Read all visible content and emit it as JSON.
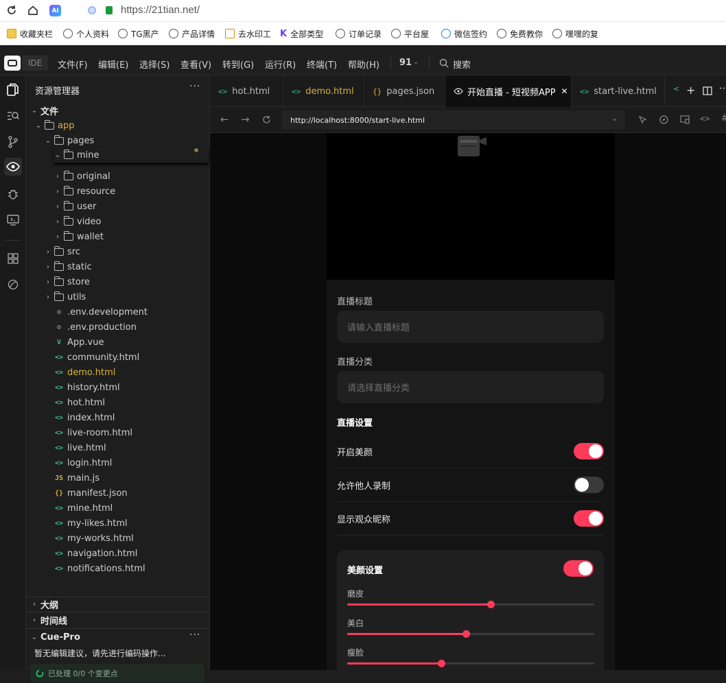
{
  "browser": {
    "url": "https://21tian.net/",
    "bookmarks": [
      "收藏夹栏",
      "个人资料",
      "TG黑产",
      "产品详情",
      "去水印工",
      "全部类型",
      "订单记录",
      "平台屋",
      "微信签约",
      "免费教你",
      "嘿嘿的复"
    ]
  },
  "ide": {
    "badge": "IDE",
    "menus": [
      "文件(F)",
      "编辑(E)",
      "选择(S)",
      "查看(V)",
      "转到(G)",
      "运行(R)",
      "终端(T)",
      "帮助(H)"
    ],
    "ext_count": "91",
    "search_label": "搜索"
  },
  "explorer": {
    "title": "资源管理器",
    "section": "文件",
    "root": "app",
    "pages_folder": "pages",
    "mine_folder": "mine",
    "tree": [
      {
        "name": "original",
        "type": "folder",
        "indent": 2
      },
      {
        "name": "resource",
        "type": "folder",
        "indent": 2
      },
      {
        "name": "user",
        "type": "folder",
        "indent": 2
      },
      {
        "name": "video",
        "type": "folder",
        "indent": 2
      },
      {
        "name": "wallet",
        "type": "folder",
        "indent": 2
      },
      {
        "name": "src",
        "type": "folder",
        "indent": 1
      },
      {
        "name": "static",
        "type": "folder",
        "indent": 1
      },
      {
        "name": "store",
        "type": "folder",
        "indent": 1
      },
      {
        "name": "utils",
        "type": "folder",
        "indent": 1
      },
      {
        "name": ".env.development",
        "type": "gear"
      },
      {
        "name": ".env.production",
        "type": "gear"
      },
      {
        "name": "App.vue",
        "type": "vue"
      },
      {
        "name": "community.html",
        "type": "html"
      },
      {
        "name": "demo.html",
        "type": "html",
        "modified": "2"
      },
      {
        "name": "history.html",
        "type": "html"
      },
      {
        "name": "hot.html",
        "type": "html"
      },
      {
        "name": "index.html",
        "type": "html"
      },
      {
        "name": "live-room.html",
        "type": "html"
      },
      {
        "name": "live.html",
        "type": "html"
      },
      {
        "name": "login.html",
        "type": "html"
      },
      {
        "name": "main.js",
        "type": "js"
      },
      {
        "name": "manifest.json",
        "type": "json"
      },
      {
        "name": "mine.html",
        "type": "html"
      },
      {
        "name": "my-likes.html",
        "type": "html"
      },
      {
        "name": "my-works.html",
        "type": "html"
      },
      {
        "name": "navigation.html",
        "type": "html"
      },
      {
        "name": "notifications.html",
        "type": "html"
      }
    ],
    "outline": "大纲",
    "timeline": "时间线",
    "cue_pro": "Cue-Pro",
    "cue_message": "暂无编辑建议，请先进行编码操作...",
    "cue_status": "已处理 0/0 个变更点"
  },
  "tabs": [
    {
      "label": "hot.html",
      "icon": "<>"
    },
    {
      "label": "demo.html",
      "icon": "<>",
      "modified": true
    },
    {
      "label": "pages.json",
      "icon": "{}"
    },
    {
      "label": "开始直播 - 短视频APP",
      "icon": "eye",
      "active": true
    },
    {
      "label": "start-live.html",
      "icon": "<>"
    }
  ],
  "preview": {
    "url": "http://localhost:8000/start-live.html",
    "title_label": "直播标题",
    "title_placeholder": "请输入直播标题",
    "category_label": "直播分类",
    "category_placeholder": "请选择直播分类",
    "settings_heading": "直播设置",
    "settings": [
      {
        "label": "开启美颜",
        "on": true
      },
      {
        "label": "允许他人录制",
        "on": false
      },
      {
        "label": "显示观众昵称",
        "on": true
      }
    ],
    "beauty": {
      "heading": "美颜设置",
      "on": true,
      "sliders": [
        {
          "label": "磨皮",
          "value": 0.58
        },
        {
          "label": "美白",
          "value": 0.48
        },
        {
          "label": "瘦脸",
          "value": 0.38
        }
      ]
    }
  },
  "colors": {
    "accent": "#ff3b5c",
    "modified": "#d7b13a",
    "html_icon": "#3fbf9f",
    "toggle_off": "#3a3a3a"
  }
}
